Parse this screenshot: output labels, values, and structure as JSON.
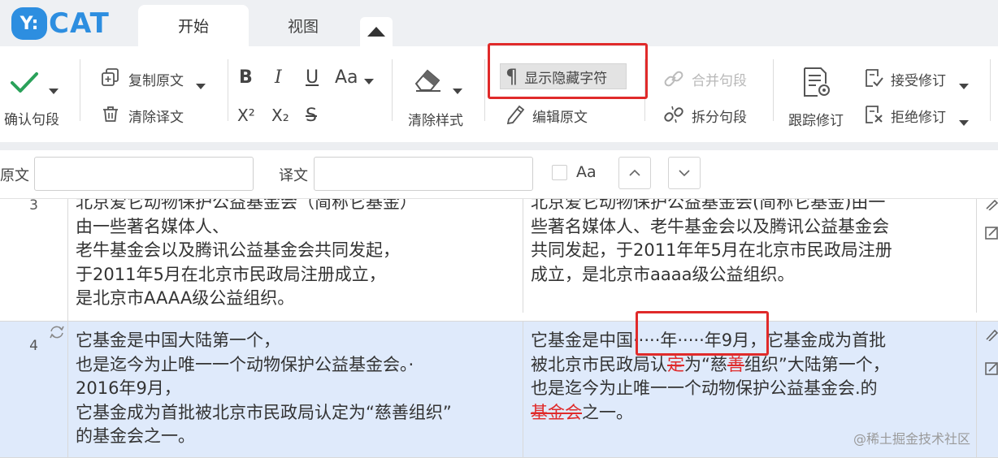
{
  "app": {
    "logo_badge": "Y:",
    "logo_text": "CAT",
    "brand_color": "#2d8ee0"
  },
  "tabs": [
    {
      "label": "开始",
      "active": true
    },
    {
      "label": "视图",
      "active": false
    }
  ],
  "ribbon": {
    "confirm_segment": "确认句段",
    "copy_source": "复制原文",
    "clear_translation": "清除译文",
    "bold": "B",
    "italic": "I",
    "underline": "U",
    "font_case": "Aa",
    "superscript": "X²",
    "subscript": "X₂",
    "strikethrough": "S",
    "clear_style": "清除样式",
    "show_hidden_chars": "显示隐藏字符",
    "pilcrow": "¶",
    "edit_source": "编辑原文",
    "merge_segments": "合并句段",
    "split_segments": "拆分句段",
    "track_changes": "跟踪修订",
    "accept_changes": "接受修订",
    "reject_changes": "拒绝修订"
  },
  "filter": {
    "source_label": "原文",
    "target_label": "译文",
    "source_value": "",
    "target_value": "",
    "match_case_label": "Aa"
  },
  "segments": [
    {
      "num": "3",
      "source_lines": [
        "北京爱它动物保护公益基金会（简称它基金）",
        "由一些著名媒体人、",
        "老牛基金会以及腾讯公益基金会共同发起，",
        "于2011年5月在北京市民政局注册成立，",
        "是北京市AAAA级公益组织。"
      ],
      "target_lines": [
        "北京爱它动物保护公益基金会(简称它基金)由一",
        "些著名媒体人、老牛基金会以及腾讯公益基金会",
        "共同发起，于2011年年5月在北京市民政局注册",
        "成立，是北京市aaaa级公益组织。"
      ]
    },
    {
      "num": "4",
      "source_lines": [
        "它基金是中国大陆第一个，",
        "也是迄今为止唯一一个动物保护公益基金会。·",
        "2016年9月，",
        "它基金成为首批被北京市民政局认定为“慈善组织”",
        "的基金会之一。"
      ],
      "target_l1": "它基金是中国·····年·····年9月，它基金成为首批",
      "target_l2_a": "被北京市民政局认",
      "target_l2_del1": "定",
      "target_l2_b": "为“慈",
      "target_l2_del2": "善",
      "target_l2_c": "组织”大陆第一个，",
      "target_l3": "也是迄今为止唯一一个动物保护公益基金会.的",
      "target_l4_del": "基金会",
      "target_l4_b": "之一。"
    }
  ],
  "watermark": "@稀土掘金技术社区",
  "colors": {
    "highlight_box": "#e02a2a",
    "selected_row": "#dfeafb",
    "confirm_check": "#2aa15a"
  }
}
